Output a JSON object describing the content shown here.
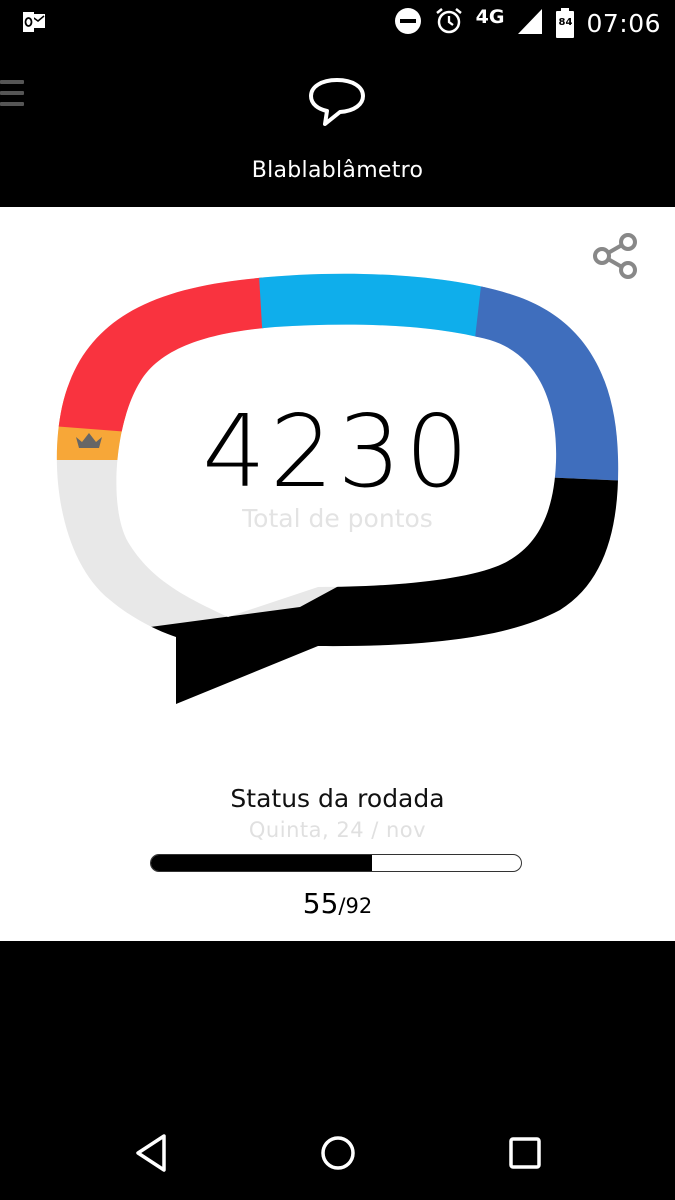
{
  "status_bar": {
    "time": "07:06",
    "network": "4G",
    "battery": "84",
    "icons": [
      "outlook-icon",
      "do-not-disturb-icon",
      "alarm-icon",
      "signal-icon",
      "battery-icon"
    ]
  },
  "header": {
    "title": "Blablablâmetro",
    "logo_icon": "speech-bubble-icon",
    "menu_icon": "hamburger-menu-icon"
  },
  "gauge": {
    "score": "4230",
    "score_label": "Total de pontos",
    "segments": [
      {
        "name": "orange",
        "color": "#F7A738"
      },
      {
        "name": "red",
        "color": "#F9333F"
      },
      {
        "name": "cyan",
        "color": "#0FAEEB"
      },
      {
        "name": "blue",
        "color": "#3F6EBD"
      },
      {
        "name": "black",
        "color": "#000000"
      }
    ],
    "track_color": "#E8E8E8"
  },
  "round_status": {
    "title": "Status da rodada",
    "date": "Quinta, 24 / nov",
    "current": "55",
    "separator": "/",
    "total": "92",
    "progress_fraction": 0.598
  }
}
